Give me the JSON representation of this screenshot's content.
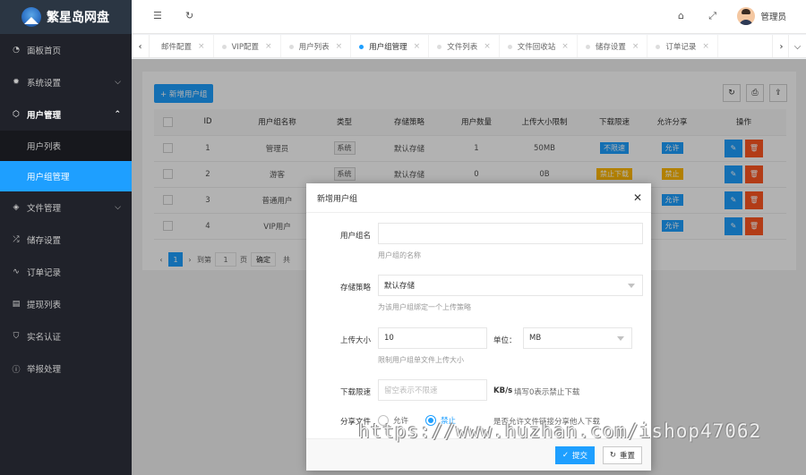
{
  "app": {
    "title": "繁星岛网盘"
  },
  "sidebar": {
    "items": [
      {
        "label": "面板首页",
        "icon": "dashboard-icon"
      },
      {
        "label": "系统设置",
        "icon": "gear-icon"
      },
      {
        "label": "用户管理",
        "icon": "cube-icon"
      },
      {
        "label": "文件管理",
        "icon": "layers-icon"
      },
      {
        "label": "储存设置",
        "icon": "shuffle-icon"
      },
      {
        "label": "订单记录",
        "icon": "pulse-icon"
      },
      {
        "label": "提现列表",
        "icon": "list-icon"
      },
      {
        "label": "实名认证",
        "icon": "shield-icon"
      },
      {
        "label": "举报处理",
        "icon": "info-icon"
      }
    ],
    "sub_items": [
      {
        "label": "用户列表"
      },
      {
        "label": "用户组管理"
      }
    ]
  },
  "header": {
    "user_name": "管理员"
  },
  "tabs": [
    {
      "label": "邮件配置"
    },
    {
      "label": "VIP配置"
    },
    {
      "label": "用户列表"
    },
    {
      "label": "用户组管理"
    },
    {
      "label": "文件列表"
    },
    {
      "label": "文件回收站"
    },
    {
      "label": "储存设置"
    },
    {
      "label": "订单记录"
    }
  ],
  "toolbar": {
    "add_label": "+ 新增用户组"
  },
  "table": {
    "headers": [
      "ID",
      "用户组名称",
      "类型",
      "存储策略",
      "用户数量",
      "上传大小限制",
      "下载限速",
      "允许分享",
      "操作"
    ],
    "rows": [
      {
        "id": "1",
        "name": "管理员",
        "type": "系统",
        "policy": "默认存储",
        "count": "1",
        "upload": "50MB",
        "speed": "不限速",
        "share": "允许"
      },
      {
        "id": "2",
        "name": "游客",
        "type": "系统",
        "policy": "默认存储",
        "count": "0",
        "upload": "0B",
        "speed": "禁止下载",
        "share": "禁止"
      },
      {
        "id": "3",
        "name": "普通用户",
        "type": "",
        "policy": "",
        "count": "",
        "upload": "",
        "speed": "",
        "share": "允许"
      },
      {
        "id": "4",
        "name": "VIP用户",
        "type": "",
        "policy": "",
        "count": "",
        "upload": "",
        "speed": "",
        "share": "允许"
      }
    ]
  },
  "pager": {
    "current": "1",
    "goto_label": "到第",
    "goto_value": "1",
    "page_label": "页",
    "confirm": "确定",
    "total_prefix": "共"
  },
  "modal": {
    "title": "新增用户组",
    "name_label": "用户组名",
    "name_hint": "用户组的名称",
    "policy_label": "存储策略",
    "policy_value": "默认存储",
    "policy_hint": "为该用户组绑定一个上传策略",
    "size_label": "上传大小",
    "size_value": "10",
    "unit_label": "单位：",
    "unit_value": "MB",
    "size_hint": "限制用户组单文件上传大小",
    "speed_label": "下载限速",
    "speed_placeholder": "留空表示不限速",
    "speed_unit": "KB/s",
    "speed_hint": "填写0表示禁止下载",
    "share_label": "分享文件",
    "share_allow": "允许",
    "share_deny": "禁止",
    "share_hint": "是否允许文件链接分享他人下载",
    "submit": "提交",
    "reset": "重置"
  },
  "watermark": "https://www.huzhan.com/ishop47062"
}
